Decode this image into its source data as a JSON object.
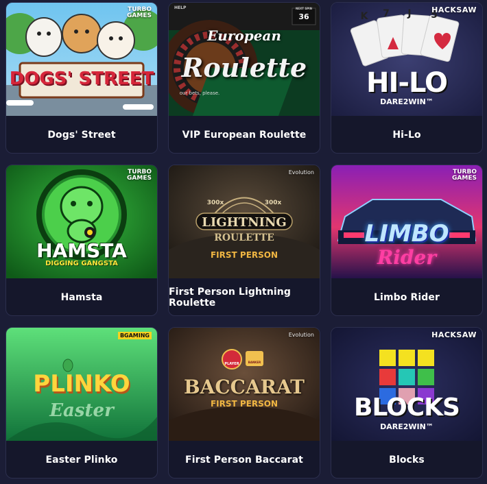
{
  "games": [
    {
      "title": "Dogs' Street",
      "provider": "TURBO GAMES",
      "art_text": "DOGS' STREET"
    },
    {
      "title": "VIP European Roulette",
      "provider": "",
      "art_text_top": "European",
      "art_text_main": "Roulette",
      "art_small": "HELP",
      "art_small2": "NEXT SPIN",
      "art_numbers": "36",
      "art_bets": "our bets, please."
    },
    {
      "title": "Hi-Lo",
      "provider": "HACKSAW",
      "art_text": "HI-LO",
      "art_sub": "DARE2WIN™",
      "cards": [
        "K",
        "7",
        "J",
        "5"
      ]
    },
    {
      "title": "Hamsta",
      "provider": "TURBO GAMES",
      "art_text": "HAMSTA",
      "art_sub": "DIGGING GANGSTA"
    },
    {
      "title": "First Person Lightning Roulette",
      "provider": "Evolution",
      "art_text": "LIGHTNING",
      "art_sub": "ROULETTE",
      "art_sub2": "FIRST PERSON",
      "multiplier": "300x"
    },
    {
      "title": "Limbo Rider",
      "provider": "TURBO GAMES",
      "art_text": "LIMBO",
      "art_sub": "Rider"
    },
    {
      "title": "Easter Plinko",
      "provider": "BGAMING",
      "art_text": "PLINKO",
      "art_sub": "Easter"
    },
    {
      "title": "First Person Baccarat",
      "provider": "Evolution",
      "art_text": "BACCARAT",
      "art_sub": "FIRST PERSON",
      "chip1": "PLAYER",
      "chip2": "BANKER"
    },
    {
      "title": "Blocks",
      "provider": "HACKSAW",
      "art_text": "BLOCKS",
      "art_sub": "DARE2WIN™"
    }
  ],
  "colors": {
    "background": "#1b1d36",
    "card": "#15172b",
    "text": "#ffffff"
  }
}
